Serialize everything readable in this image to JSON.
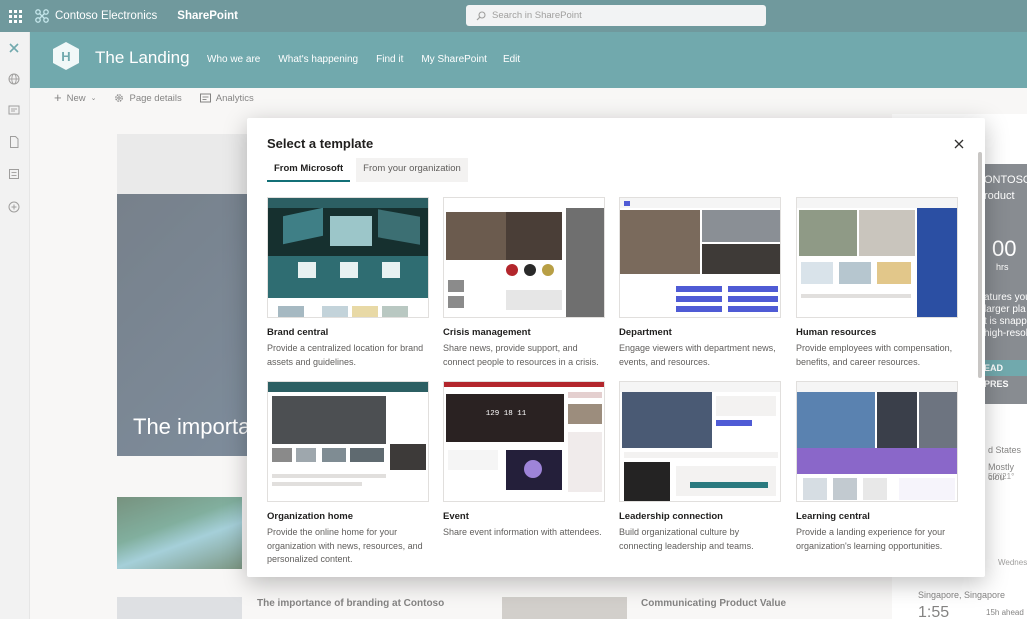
{
  "suite": {
    "org_name": "Contoso Electronics",
    "app_name": "SharePoint",
    "search_placeholder": "Search in SharePoint"
  },
  "site": {
    "title": "The Landing",
    "nav": [
      "Who we are",
      "What's happening",
      "Find it",
      "My SharePoint",
      "Edit"
    ]
  },
  "command_bar": {
    "new_label": "New",
    "page_details_label": "Page details",
    "analytics_label": "Analytics"
  },
  "page": {
    "hero_text": "The importa",
    "news1_title": "The importance of branding at Contoso",
    "news2_title": "Communicating Product Value",
    "promo": [
      "ONTOSO",
      "roduct",
      "00",
      "hrs",
      "atures you\nlarger pla\nt is snapp\nhigh-resol",
      "EAD PRES"
    ],
    "weather_location": "d States",
    "weather_desc": "Mostly clou",
    "weather_temp": "50°|21°",
    "weather_day": "Wednes",
    "clock_location": "Singapore, Singapore",
    "clock_time": "1:55",
    "clock_ahead": "15h ahead"
  },
  "modal": {
    "title": "Select a template",
    "tabs": [
      "From Microsoft",
      "From your organization"
    ],
    "templates": [
      {
        "title": "Brand central",
        "description": "Provide a centralized location for brand assets and guidelines."
      },
      {
        "title": "Crisis management",
        "description": "Share news, provide support, and connect people to resources in a crisis."
      },
      {
        "title": "Department",
        "description": "Engage viewers with department news, events, and resources."
      },
      {
        "title": "Human resources",
        "description": "Provide employees with compensation, benefits, and career resources."
      },
      {
        "title": "Organization home",
        "description": "Provide the online home for your organization with news, resources, and personalized content."
      },
      {
        "title": "Event",
        "description": "Share event information with attendees."
      },
      {
        "title": "Leadership connection",
        "description": "Build organizational culture by connecting leadership and teams."
      },
      {
        "title": "Learning central",
        "description": "Provide a landing experience for your organization's learning opportunities."
      }
    ],
    "event_countdown": "129  18  11"
  },
  "colors": {
    "suite_bar": "#11565c",
    "site_header": "#137077",
    "accent": "#137077"
  },
  "icons": [
    "waffle-icon",
    "contoso-logo-icon",
    "search-icon",
    "close-icon",
    "add-icon",
    "chevron-down-icon",
    "settings-icon",
    "analytics-icon",
    "site-logo-icon"
  ]
}
